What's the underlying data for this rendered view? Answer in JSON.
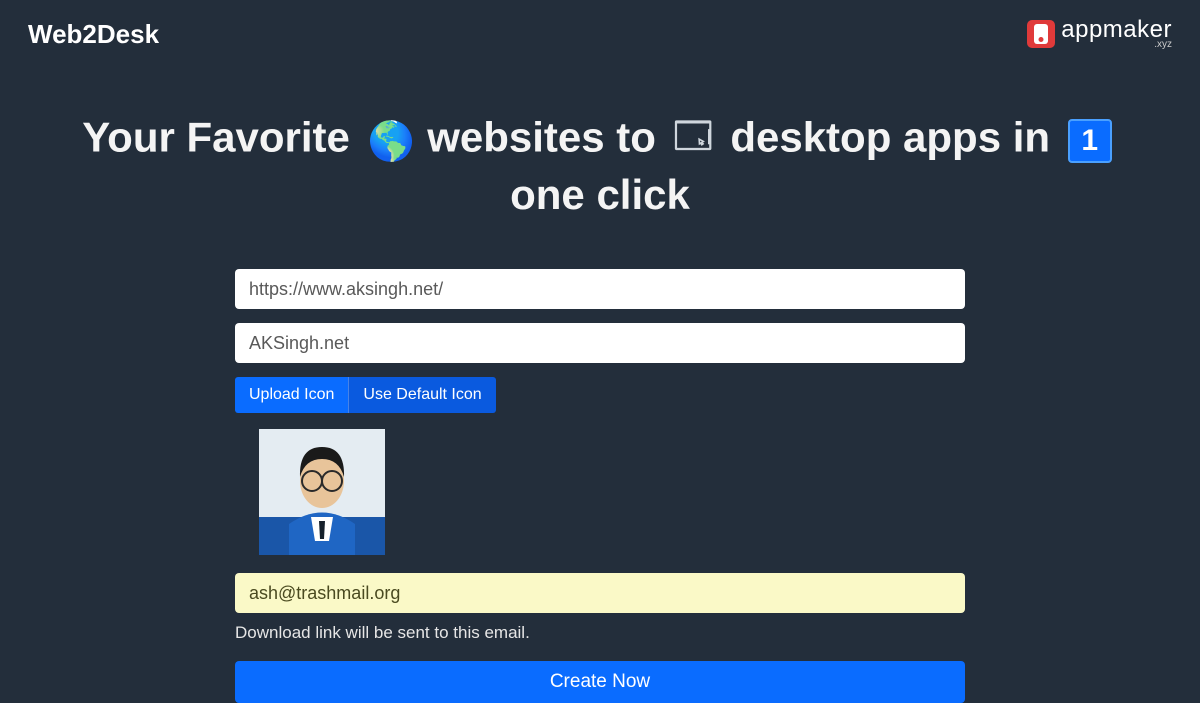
{
  "header": {
    "brand": "Web2Desk",
    "partner_name": "appmaker",
    "partner_sub": ".xyz"
  },
  "hero": {
    "part1": "Your Favorite",
    "part2": "websites to",
    "part3": "desktop apps in",
    "part4": "one click",
    "one_label": "1"
  },
  "form": {
    "url_value": "https://www.aksingh.net/",
    "name_value": "AKSingh.net",
    "upload_label": "Upload Icon",
    "default_label": "Use Default Icon",
    "email_value": "ash@trashmail.org",
    "helper_text": "Download link will be sent to this email.",
    "submit_label": "Create Now"
  }
}
